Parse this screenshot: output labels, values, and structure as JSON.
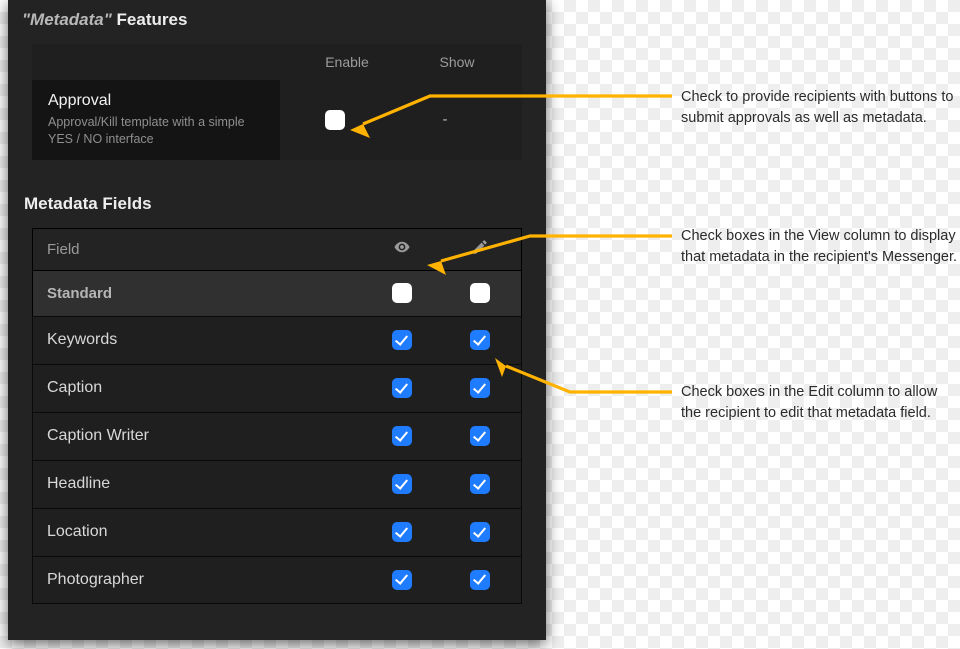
{
  "colors": {
    "accent_arrow": "#ffb300",
    "checkbox_blue": "#1f7cff",
    "checkbox_white": "#ffffff"
  },
  "features_section": {
    "title_prefix": "\"Metadata\"",
    "title_suffix": " Features",
    "columns": {
      "enable": "Enable",
      "show": "Show"
    },
    "rows": [
      {
        "name": "Approval",
        "description": "Approval/Kill template with a simple YES / NO interface",
        "enable_checked": false,
        "show_value": "-"
      }
    ]
  },
  "fields_section": {
    "title": "Metadata Fields",
    "header_label": "Field",
    "columns": {
      "view": "view-icon",
      "edit": "edit-icon"
    },
    "group": {
      "label": "Standard",
      "view_checked": false,
      "edit_checked": false
    },
    "rows": [
      {
        "label": "Keywords",
        "view_checked": true,
        "edit_checked": true
      },
      {
        "label": "Caption",
        "view_checked": true,
        "edit_checked": true
      },
      {
        "label": "Caption Writer",
        "view_checked": true,
        "edit_checked": true
      },
      {
        "label": "Headline",
        "view_checked": true,
        "edit_checked": true
      },
      {
        "label": "Location",
        "view_checked": true,
        "edit_checked": true
      },
      {
        "label": "Photographer",
        "view_checked": true,
        "edit_checked": true
      }
    ]
  },
  "annotations": {
    "a1": "Check to provide recipients with buttons to submit approvals as well as metadata.",
    "a2": "Check boxes in the View column to display that metadata in the recipient's Messenger.",
    "a3": "Check boxes in the Edit column to allow the recipient to edit that metadata field."
  }
}
